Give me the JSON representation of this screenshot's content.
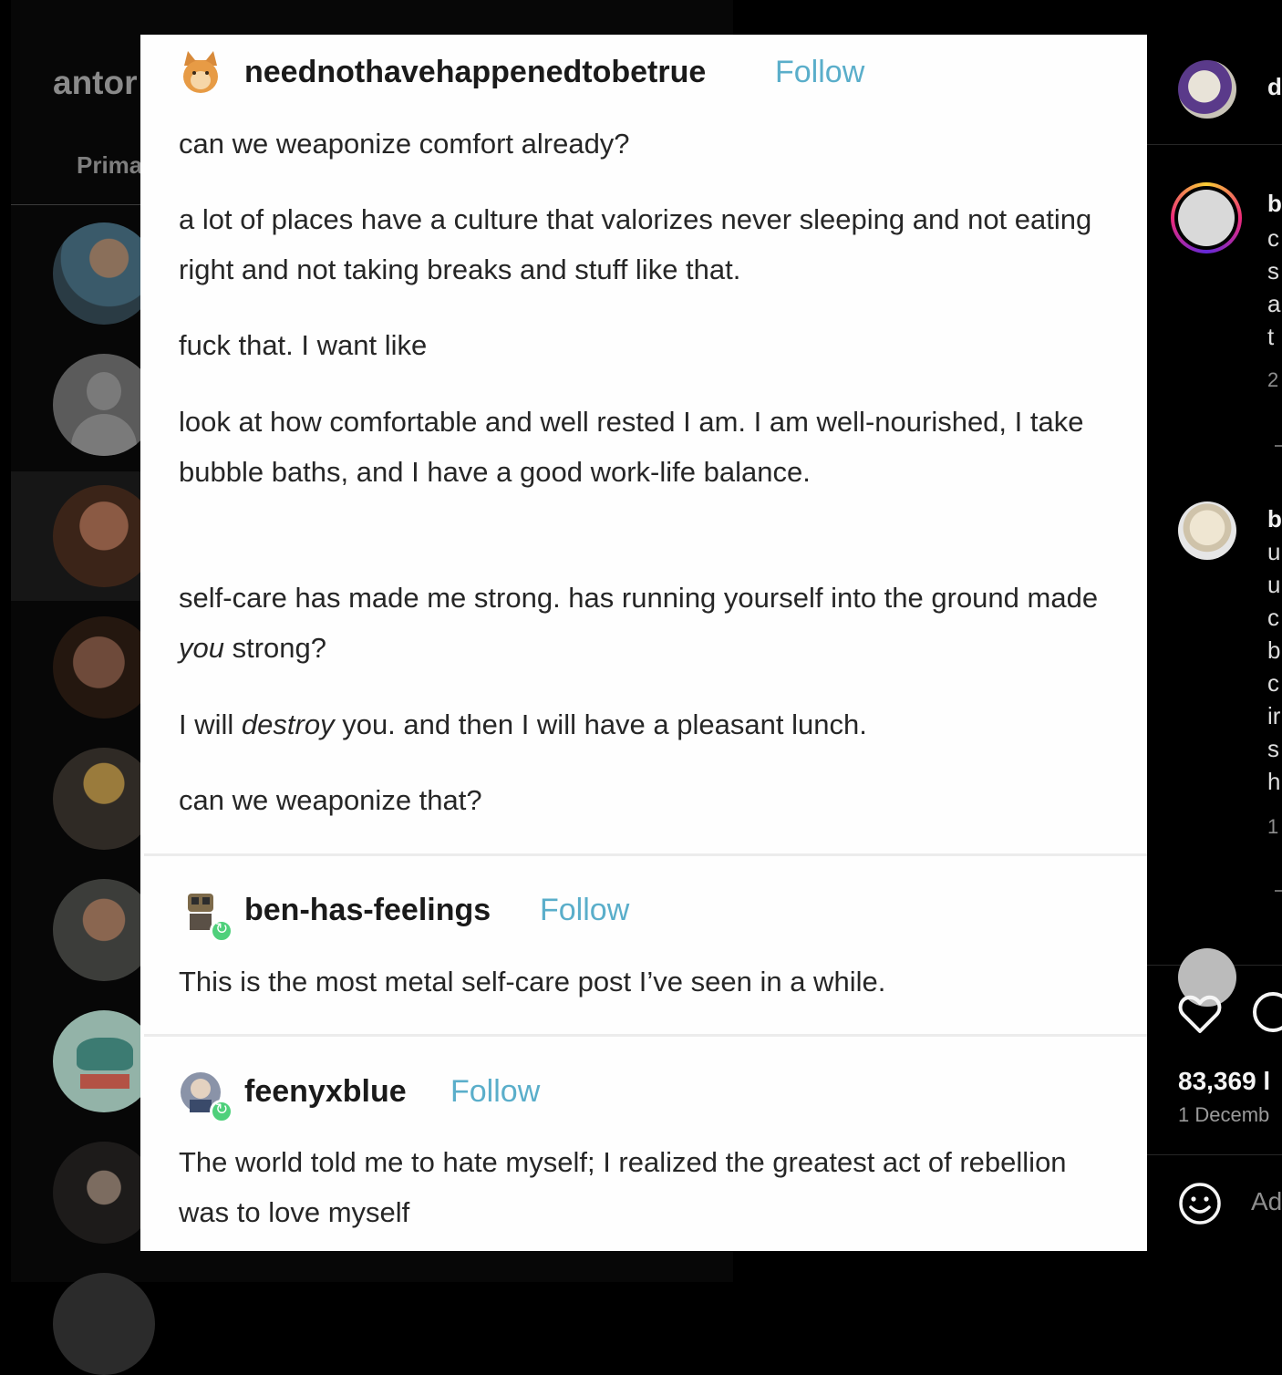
{
  "left_panel": {
    "account_name": "antor",
    "tab_primary": "Prima"
  },
  "post": {
    "author": {
      "blog": "neednothavehappenedtobetrue",
      "follow": "Follow",
      "paragraphs": [
        "can we weaponize comfort already?",
        "a lot of places have a culture that valorizes never sleeping and not eating right and not taking breaks and stuff like that.",
        "fuck that. I want like",
        "look at how comfortable and well rested I am. I am well-nourished, I take bubble baths, and I have a good work-life balance.",
        "self-care has made me strong. has running yourself into the ground made",
        "you",
        "strong?",
        "I will",
        "destroy",
        "you. and then I will have a pleasant lunch.",
        "can we weaponize that?"
      ]
    },
    "reblogs": [
      {
        "blog": "ben-has-feelings",
        "follow": "Follow",
        "text": "This is the most metal self-care post I’ve seen in a while."
      },
      {
        "blog": "feenyxblue",
        "follow": "Follow",
        "text": "The world told me to hate myself; I realized the greatest act of rebellion was to love myself"
      }
    ]
  },
  "right_panel": {
    "header_username": "d",
    "comments": [
      {
        "username": "b",
        "lines": [
          "c",
          "s",
          "a",
          "t"
        ],
        "meta": "2"
      },
      {
        "username": "b",
        "lines": [
          "u",
          "u",
          "c",
          "b",
          "c",
          "ir",
          "s",
          "h"
        ],
        "meta": "1"
      }
    ],
    "likes": "83,369 l",
    "date": "1 Decemb",
    "add_comment": "Ad"
  },
  "colors": {
    "follow_link": "#5aaeca",
    "reblog_badge": "#4fd07b",
    "background": "#000000"
  },
  "icons": [
    "heart-icon",
    "comment-icon",
    "emoji-icon",
    "reblog-icon"
  ]
}
